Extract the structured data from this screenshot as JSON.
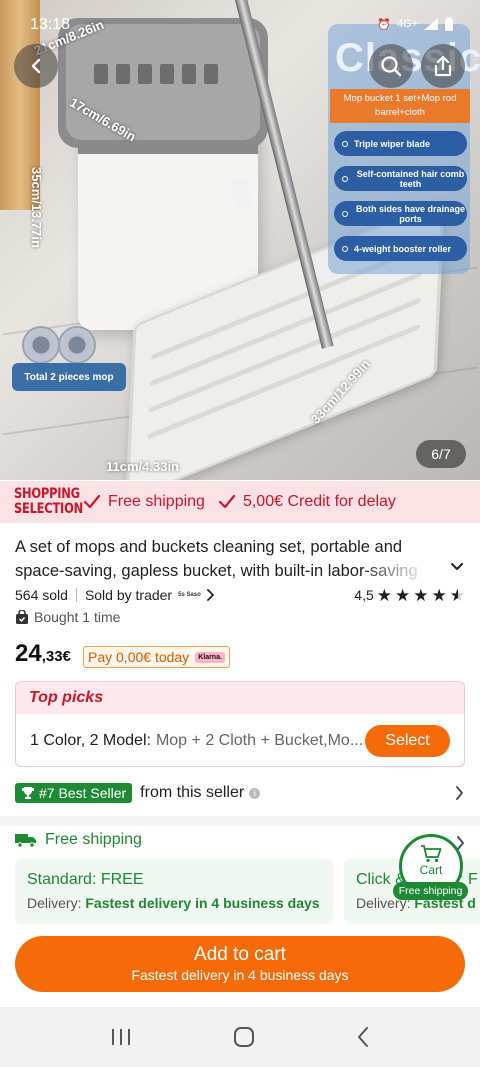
{
  "status_bar": {
    "time": "13:18",
    "network": "4G+"
  },
  "hero": {
    "image_counter": "6/7",
    "spec_title": "Classic",
    "spec_subtitle": "Mop bucket 1 set+Mop rod barrel+cloth",
    "features": [
      "Triple wiper blade",
      "Self-contained hair comb teeth",
      "Both sides have drainage ports",
      "4-weight booster roller"
    ],
    "total_pieces": "Total 2 pieces mop",
    "dimensions": {
      "top_width": "21cm/8.26in",
      "depth": "17cm/6.69in",
      "height": "35cm/13.77in",
      "mop_length": "33cm/12.99in",
      "mop_width": "11cm/4.33in"
    }
  },
  "promo": {
    "logo_line1": "SHOPPING",
    "logo_line2": "SELECTION",
    "item1": "Free shipping",
    "item2": "5,00€ Credit for delay"
  },
  "product": {
    "title": "A set of mops and buckets cleaning set, portable and space-saving, gapless bucket, with built-in labor-saving",
    "sold": "564 sold",
    "sold_by": "Sold by trader",
    "seller_logo": "5s Saso",
    "rating": "4,5",
    "bought": "Bought 1 time",
    "price_int": "24",
    "price_dec": ",33€",
    "klarna_text": "Pay 0,00€ today",
    "klarna_logo": "Klarna."
  },
  "top_picks": {
    "heading": "Top picks",
    "label": "1 Color, 2 Model:",
    "value": "Mop + 2 Cloth + Bucket,Mo...",
    "select": "Select"
  },
  "best_seller": {
    "badge": "#7 Best Seller",
    "text": "from this seller"
  },
  "shipping": {
    "heading": "Free shipping",
    "cards": [
      {
        "title": "Standard: FREE",
        "desc_prefix": "Delivery:",
        "desc_highlight": "Fastest delivery in 4 business days"
      },
      {
        "title": "Click & Collect: F",
        "desc_prefix": "Delivery:",
        "desc_highlight": "Fastest d"
      }
    ],
    "cart_label": "Cart",
    "cart_tag": "Free shipping"
  },
  "add_to_cart": {
    "label": "Add to cart",
    "sub": "Fastest delivery in 4 business days"
  },
  "colors": {
    "accent": "#f56b0a",
    "green": "#1e8a34",
    "red": "#d0152a"
  }
}
